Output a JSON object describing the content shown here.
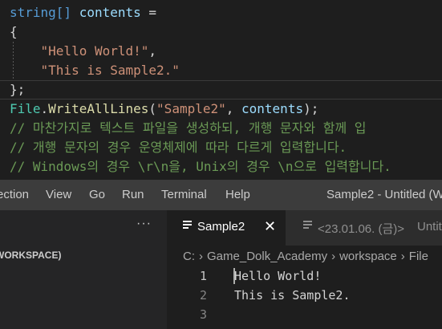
{
  "code_snippet": {
    "line1": {
      "type": "string[]",
      "var": "contents",
      "op": " ="
    },
    "line2": "{",
    "line3": {
      "str": "\"Hello World!\"",
      "punct": ","
    },
    "line4": {
      "str": "\"This is Sample2.\""
    },
    "line5": "};",
    "line6": {
      "cls": "File",
      "dot": ".",
      "fn": "WriteAllLines",
      "open": "(",
      "arg1": "\"Sample2\"",
      "comma": ", ",
      "arg2": "contents",
      "close": ");"
    },
    "comment1": "// 마찬가지로 텍스트 파일을 생성하되, 개행 문자와 함께 입",
    "comment2": "// 개행 문자의 경우 운영체제에 따라 다르게 입력합니다.",
    "comment3": "// Windows의 경우 \\r\\n을, Unix의 경우 \\n으로 입력합니다."
  },
  "menubar": {
    "items": [
      "ection",
      "View",
      "Go",
      "Run",
      "Terminal",
      "Help"
    ],
    "window_title": "Sample2 - Untitled (W"
  },
  "sidebar": {
    "more_label": "···",
    "workspace_label": "(WORKSPACE)"
  },
  "tabs": {
    "active": {
      "label": "Sample2",
      "close": "✕",
      "icon": "file-lines-icon"
    },
    "inactive": {
      "label": "<23.01.06. (금)>",
      "suffix": "Untit",
      "icon": "file-lines-icon"
    }
  },
  "breadcrumb": [
    "C:",
    "Game_Dolk_Academy",
    "workspace",
    "File"
  ],
  "breadcrumb_sep": "›",
  "editor": {
    "line_numbers": [
      "1",
      "2",
      "3"
    ],
    "lines": [
      "Hello World!",
      "This is Sample2.",
      ""
    ]
  },
  "colors": {
    "background": "#1e1e1e",
    "keyword": "#569cd6",
    "string": "#ce9178",
    "comment": "#6a9955",
    "class": "#4ec9b0",
    "function": "#dcdcaa"
  }
}
